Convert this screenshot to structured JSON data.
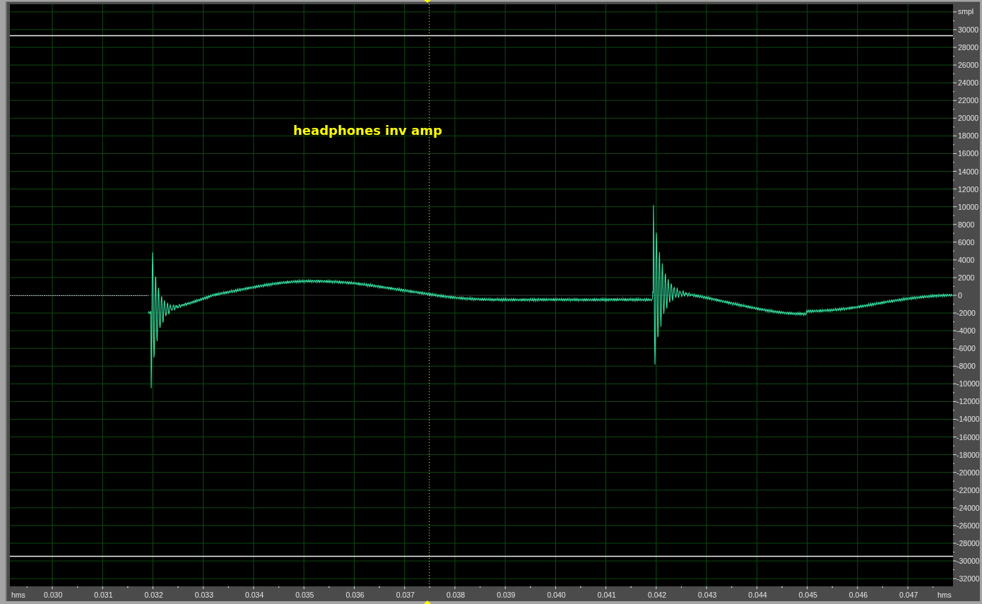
{
  "title": "headphones inv amp",
  "y_axis": {
    "unit": "smpl",
    "labels": [
      "30000",
      "28000",
      "26000",
      "24000",
      "22000",
      "20000",
      "18000",
      "16000",
      "14000",
      "12000",
      "10000",
      "8000",
      "6000",
      "4000",
      "2000",
      "0",
      "-2000",
      "-4000",
      "-6000",
      "-8000",
      "-10000",
      "-12000",
      "-14000",
      "-16000",
      "-18000",
      "-20000",
      "-22000",
      "-24000",
      "-26000",
      "-28000",
      "-30000",
      "-32000"
    ]
  },
  "x_axis": {
    "unit_left": "hms",
    "unit_right": "hms",
    "labels": [
      "0.030",
      "0.031",
      "0.032",
      "0.033",
      "0.034",
      "0.035",
      "0.036",
      "0.037",
      "0.038",
      "0.039",
      "0.040",
      "0.041",
      "0.042",
      "0.043",
      "0.044",
      "0.045",
      "0.046",
      "0.047"
    ]
  }
}
